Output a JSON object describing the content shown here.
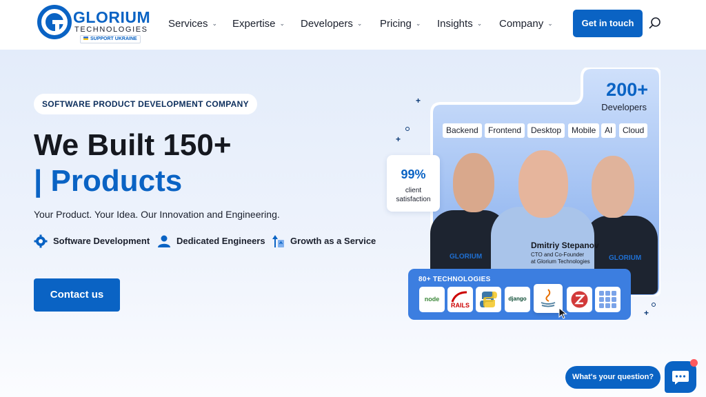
{
  "brand": {
    "name": "GLORIUM",
    "subtitle": "TECHNOLOGIES",
    "ukraine_badge": "SUPPORT UKRAINE",
    "color": "#0a63c4"
  },
  "nav": {
    "items": [
      {
        "label": "Services",
        "icon": "chevron-down-icon"
      },
      {
        "label": "Expertise",
        "icon": "chevron-down-icon"
      },
      {
        "label": "Developers",
        "icon": "chevron-down-icon"
      },
      {
        "label": "Pricing",
        "icon": "chevron-down-icon"
      },
      {
        "label": "Insights",
        "icon": "chevron-down-icon"
      },
      {
        "label": "Company",
        "icon": "chevron-down-icon"
      }
    ],
    "cta_label": "Get in touch",
    "search_icon": "search-icon"
  },
  "hero": {
    "tag": "SOFTWARE PRODUCT DEVELOPMENT COMPANY",
    "headline_line1": "We Built 150+",
    "headline_line2": "| Products",
    "lede": "Your Product. Your Idea. Our Innovation and Engineering.",
    "features": [
      {
        "label": "Software Development",
        "icon": "gear-icon"
      },
      {
        "label": "Dedicated Engineers",
        "icon": "person-icon"
      },
      {
        "label": "Growth as a Service",
        "icon": "growth-arrows-icon"
      }
    ],
    "contact_label": "Contact us"
  },
  "visual": {
    "developers_count": "200+",
    "developers_label": "Developers",
    "chips": [
      "Backend",
      "Frontend",
      "Desktop",
      "Mobile",
      "AI",
      "Cloud"
    ],
    "satisfaction_value": "99%",
    "satisfaction_line1": "client",
    "satisfaction_line2": "satisfaction",
    "person_name": "Dmitriy Stepanov",
    "person_title_line1": "CTO and Co-Founder",
    "person_title_line2": "at Glorium Technologies",
    "shirt_logo": "GLORIUM",
    "technologies_title": "80+ TECHNOLOGIES",
    "technologies": [
      {
        "label": "node",
        "icon": "nodejs-icon"
      },
      {
        "label": "RAILS",
        "icon": "rails-icon"
      },
      {
        "label": "",
        "icon": "python-icon"
      },
      {
        "label": "django",
        "icon": "django-icon"
      },
      {
        "label": "",
        "icon": "java-icon"
      },
      {
        "label": "",
        "icon": "scala-icon"
      },
      {
        "label": "",
        "icon": "more-technologies-icon"
      }
    ]
  },
  "chat": {
    "prompt": "What's your question?",
    "icon": "chat-icon"
  }
}
